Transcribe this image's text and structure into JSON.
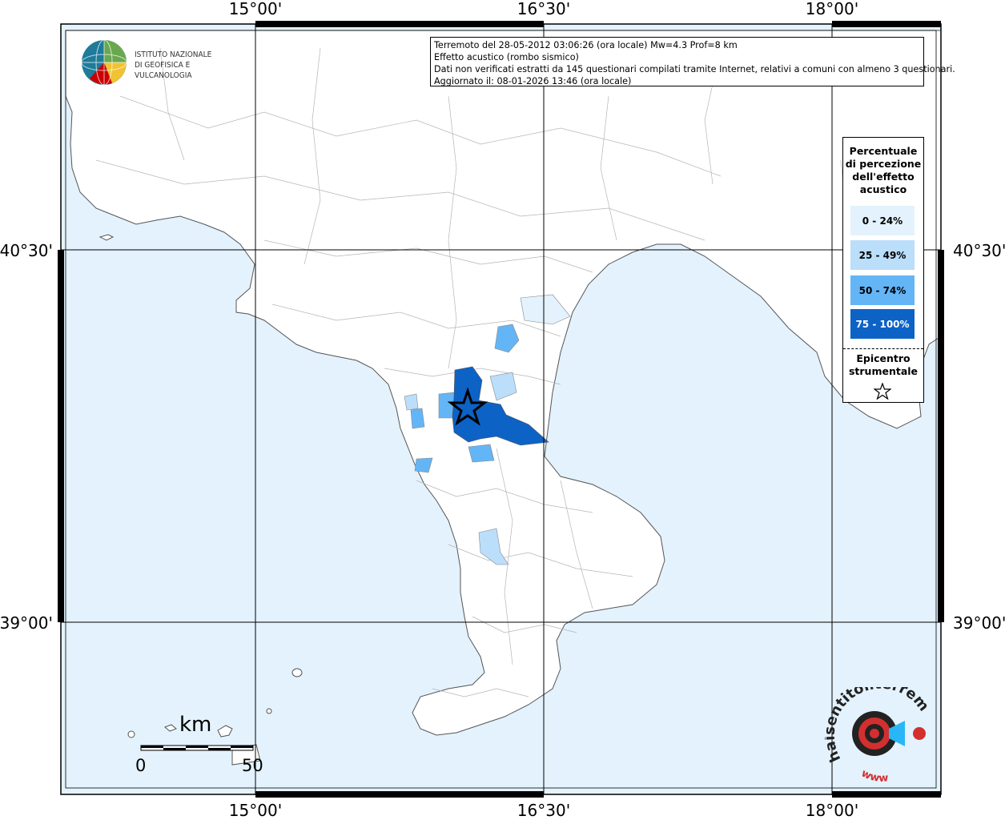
{
  "header": {
    "line1": "Terremoto del 28-05-2012 03:06:26 (ora locale) Mw=4.3 Prof=8 km",
    "line2": "Effetto acustico (rombo sismico)",
    "line3": "Dati non verificati estratti da 145 questionari compilati tramite Internet, relativi a comuni con almeno 3 questionari.",
    "line4": "Aggiornato il: 08-01-2026 13:46 (ora locale)"
  },
  "logo": {
    "line1": "ISTITUTO NAZIONALE",
    "line2": "DI GEOFISICA E VULCANOLOGIA"
  },
  "axes": {
    "lon_ticks": [
      "15°00'",
      "16°30'",
      "18°00'"
    ],
    "lat_ticks": [
      "40°30'",
      "39°00'"
    ]
  },
  "legend": {
    "title": "Percentuale di percezione dell'effetto acustico",
    "classes": [
      {
        "label": "0 - 24%",
        "color": "#e3f2fd"
      },
      {
        "label": "25 - 49%",
        "color": "#bbdefb"
      },
      {
        "label": "50 - 74%",
        "color": "#64b5f6"
      },
      {
        "label": "75 - 100%",
        "color": "#0d62c6"
      }
    ],
    "epicenter_label": "Epicentro strumentale",
    "epicenter_icon": "star-icon"
  },
  "scale": {
    "unit": "km",
    "start": "0",
    "end": "50"
  },
  "brand": {
    "text": "haisentitoilterremoto.it",
    "url": "www"
  },
  "colors": {
    "sea": "#e3f2fd",
    "land": "#ffffff",
    "borders": "#999999",
    "frame": "#000000"
  }
}
